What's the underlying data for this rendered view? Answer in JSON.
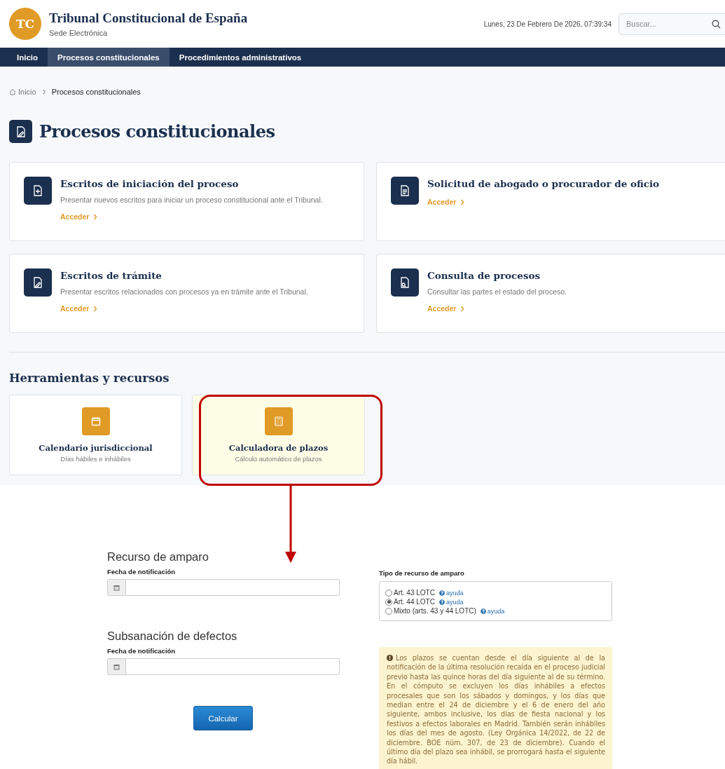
{
  "header": {
    "logo_text": "TC",
    "title": "Tribunal Constitucional de España",
    "subtitle": "Sede Electrónica",
    "datetime": "Lunes, 23 De Febrero De 2026, 07:39:34",
    "search": {
      "placeholder": "Buscar..."
    }
  },
  "nav": [
    {
      "label": "Inicio",
      "selected": false
    },
    {
      "label": "Procesos constitucionales",
      "selected": true
    },
    {
      "label": "Procedimientos administrativos",
      "selected": false
    }
  ],
  "breadcrumb": [
    {
      "label": "Inicio",
      "kind": "home"
    },
    {
      "label": "Procesos constitucionales",
      "kind": "current"
    }
  ],
  "page_title": "Procesos constitucionales",
  "process_cards": [
    {
      "title": "Escritos de iniciación del proceso",
      "description": "Presentar nuevos escritos para iniciar un proceso constitucional ante el Tribunal.",
      "link": "Acceder"
    },
    {
      "title": "Solicitud de abogado o procurador de oficio",
      "link": "Acceder"
    },
    {
      "title": "Escritos de trámite",
      "description": "Presentar escritos relacionados con procesos ya en trámite ante el Tribunal.",
      "link": "Acceder"
    },
    {
      "title": "Consulta de procesos",
      "description": "Consultar las partes el estado del proceso.",
      "link": "Acceder"
    }
  ],
  "tools_title": "Herramientas y recursos",
  "tools": [
    {
      "title": "Calendario jurisdiccional",
      "subtitle": "Días hábiles e inhábiles",
      "highlighted": false
    },
    {
      "title": "Calculadora de plazos",
      "subtitle": "Cálculo automático de plazos",
      "highlighted": true
    }
  ],
  "form": {
    "sections": [
      {
        "title": "Recurso de amparo",
        "field_label": "Fecha de notificación"
      },
      {
        "title": "Subsanación de defectos",
        "field_label": "Fecha de notificación"
      }
    ],
    "button": "Calcular",
    "radio_group": {
      "label": "Tipo de recurso de amparo",
      "options": [
        {
          "label": "Art. 43 LOTC",
          "help": "ayuda",
          "selected": false
        },
        {
          "label": "Art. 44 LOTC",
          "help": "ayuda",
          "selected": true
        },
        {
          "label": "Mixto (arts. 43 y 44 LOTC)",
          "help": "ayuda",
          "selected": false
        }
      ]
    },
    "notice": "Los plazos se cuentan desde el día siguiente al de la notificación de la última resolución recaída en el proceso judicial previo hasta las quince horas del día siguiente al de su término. En el cómputo se excluyen los días inhábiles a efectos procesales que son los sábados y domingos, y los días que median entre el 24 de diciembre y el 6 de enero del año siguiente, ambos inclusive, los días de fiesta nacional y los festivos a efectos laborales en Madrid. También serán inhábiles los días del mes de agosto. (Ley Orgánica 14/2022, de 22 de diciembre. BOE núm. 307, de 23 de diciembre). Cuando el último día del plazo sea inhábil, se prorrogará hasta el siguiente día hábil."
  }
}
